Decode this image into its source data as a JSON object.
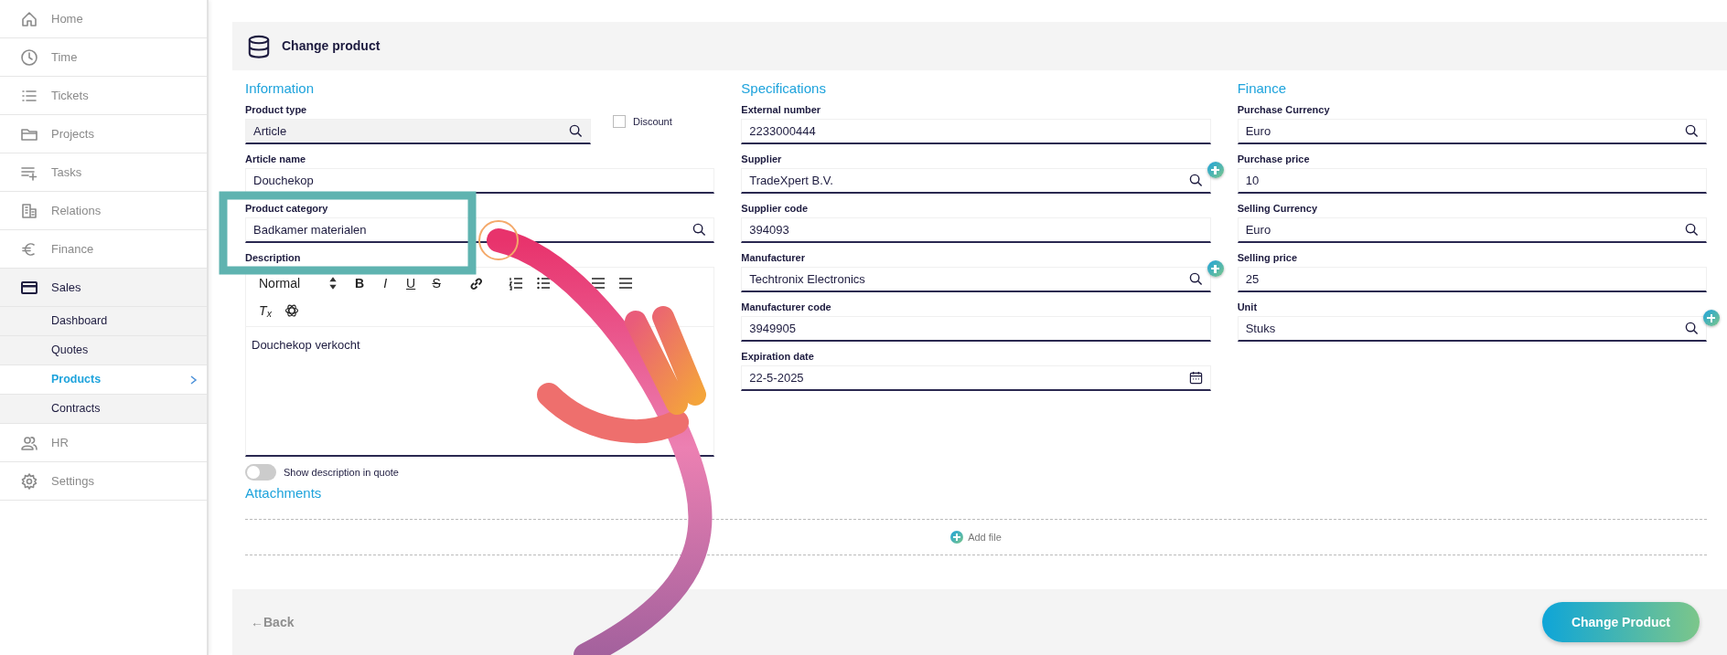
{
  "sidebar": {
    "items": [
      {
        "label": "Home",
        "expanded": false
      },
      {
        "label": "Time",
        "expanded": false
      },
      {
        "label": "Tickets",
        "expanded": false
      },
      {
        "label": "Projects",
        "expanded": false
      },
      {
        "label": "Tasks",
        "expanded": false
      },
      {
        "label": "Relations",
        "expanded": false
      },
      {
        "label": "Finance",
        "expanded": false
      },
      {
        "label": "Sales",
        "expanded": true,
        "children": [
          {
            "label": "Dashboard",
            "selected": false
          },
          {
            "label": "Quotes",
            "selected": false
          },
          {
            "label": "Products",
            "selected": true
          },
          {
            "label": "Contracts",
            "selected": false
          }
        ]
      },
      {
        "label": "HR",
        "expanded": false
      },
      {
        "label": "Settings",
        "expanded": false
      }
    ]
  },
  "header": {
    "title": "Change product"
  },
  "information": {
    "title": "Information",
    "product_type": {
      "label": "Product type",
      "value": "Article",
      "disabled": true
    },
    "discount": {
      "label": "Discount",
      "checked": false
    },
    "fields": [
      {
        "kind": "text",
        "label": "Article name",
        "value": "Douchekop",
        "addable": false
      },
      {
        "kind": "select",
        "label": "Product category",
        "value": "Badkamer materialen",
        "addable": false
      }
    ],
    "description": {
      "label": "Description",
      "format": "Normal",
      "toolbar": [
        {
          "kind": "bold",
          "label": "B"
        },
        {
          "kind": "italic",
          "label": "I"
        },
        {
          "kind": "underline",
          "label": "U"
        },
        {
          "kind": "strike",
          "label": "S"
        },
        {
          "kind": "link"
        },
        {
          "kind": "ordered-list"
        },
        {
          "kind": "bullet-list"
        },
        {
          "kind": "align"
        },
        {
          "kind": "align"
        },
        {
          "kind": "clear",
          "label": "T$_{x}$"
        },
        {
          "kind": "ai"
        }
      ],
      "content": "Douchekop verkocht"
    },
    "show_in_quote": {
      "label": "Show description in quote",
      "on": false
    }
  },
  "specifications": {
    "title": "Specifications",
    "fields": [
      {
        "kind": "text",
        "label": "External number",
        "value": "2233000444",
        "addable": false
      },
      {
        "kind": "select",
        "label": "Supplier",
        "value": "TradeXpert B.V.",
        "addable": true
      },
      {
        "kind": "text",
        "label": "Supplier code",
        "value": "394093",
        "addable": false
      },
      {
        "kind": "select",
        "label": "Manufacturer",
        "value": "Techtronix Electronics",
        "addable": true
      },
      {
        "kind": "text",
        "label": "Manufacturer code",
        "value": "3949905",
        "addable": false
      },
      {
        "kind": "date",
        "label": "Expiration date",
        "value": "22-5-2025",
        "addable": false
      }
    ]
  },
  "finance": {
    "title": "Finance",
    "fields": [
      {
        "kind": "select",
        "label": "Purchase Currency",
        "value": "Euro",
        "addable": false
      },
      {
        "kind": "text",
        "label": "Purchase price",
        "value": "10",
        "addable": false
      },
      {
        "kind": "select",
        "label": "Selling Currency",
        "value": "Euro",
        "addable": false
      },
      {
        "kind": "text",
        "label": "Selling price",
        "value": "25",
        "addable": false
      },
      {
        "kind": "select",
        "label": "Unit",
        "value": "Stuks",
        "addable": true
      }
    ]
  },
  "attachments": {
    "title": "Attachments",
    "add_label": "Add file"
  },
  "footer": {
    "back": "←Back",
    "submit": "Change Product"
  }
}
